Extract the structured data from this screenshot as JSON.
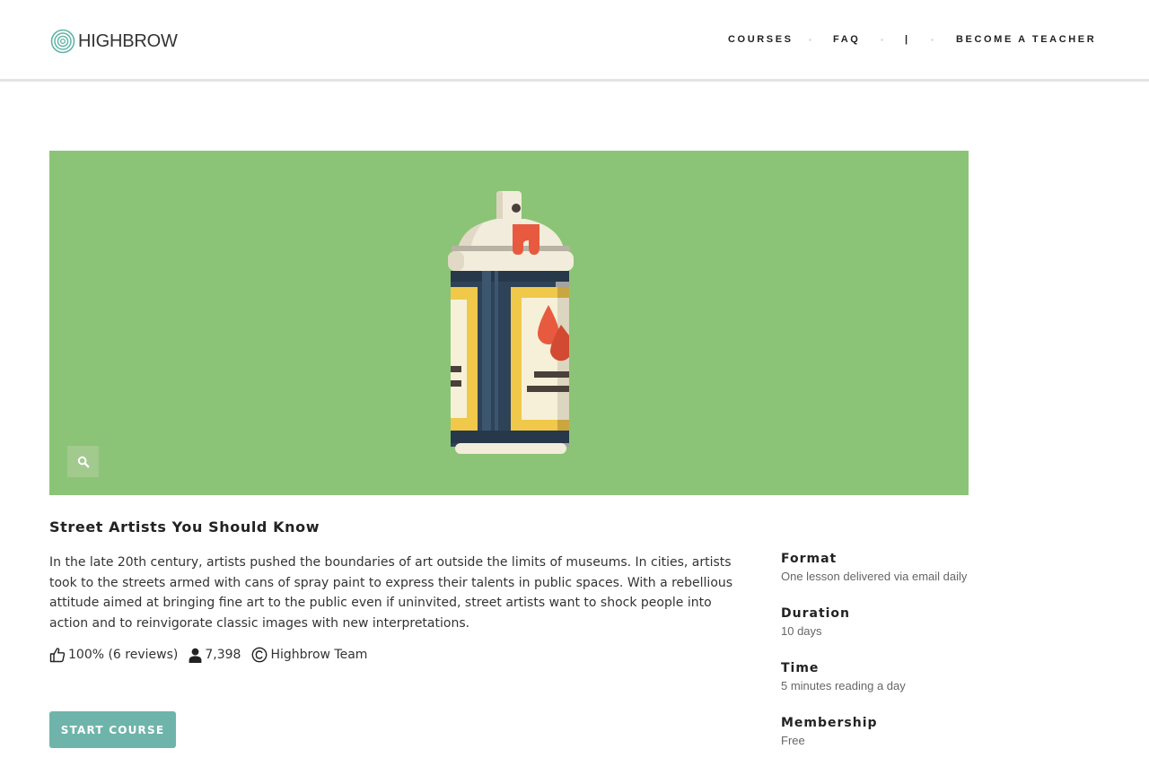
{
  "header": {
    "logo_text": "HIGHBROW",
    "nav": [
      {
        "label": "COURSES"
      },
      {
        "label": "FAQ"
      },
      {
        "label": "|"
      },
      {
        "label": "BECOME A TEACHER"
      }
    ]
  },
  "hero": {
    "background_color": "#8bc476",
    "illustration": "spray-paint-can",
    "zoom_icon": "search-icon"
  },
  "course": {
    "title": "Street Artists You Should Know",
    "description": "In the late 20th century, artists pushed the boundaries of art outside the limits of museums. In cities, artists took to the streets armed with cans of spray paint to express their talents in public spaces. With a rebellious attitude aimed at bringing fine art to the public even if uninvited, street artists want to shock people into action and to reinvigorate classic images with new interpretations.",
    "rating": "100% (6 reviews)",
    "students": "7,398",
    "author": "Highbrow Team",
    "start_label": "START COURSE",
    "start_color": "#6fb4ab"
  },
  "details": [
    {
      "label": "Format",
      "value": "One lesson delivered via email daily"
    },
    {
      "label": "Duration",
      "value": "10 days"
    },
    {
      "label": "Time",
      "value": "5 minutes reading a day"
    },
    {
      "label": "Membership",
      "value": "Free"
    }
  ]
}
